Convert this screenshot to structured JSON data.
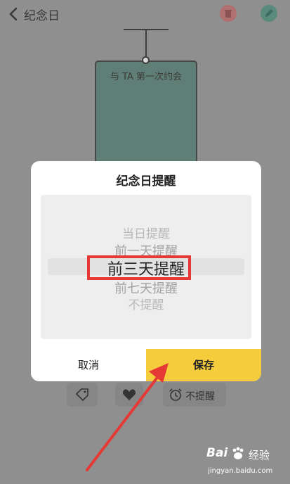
{
  "header": {
    "back_icon": "chevron-left-icon",
    "title": "纪念日",
    "delete_icon": "trash-icon",
    "edit_icon": "pencil-icon",
    "delete_color": "#b07070",
    "edit_color": "#5a8a7c"
  },
  "card": {
    "text": "与 TA 第一次约会",
    "color": "#5f7f76"
  },
  "toolbar": {
    "tag_icon": "tag-icon",
    "heart_icon": "heart-icon",
    "alarm_icon": "alarm-clock-icon",
    "remind_label": "不提醒"
  },
  "dialog": {
    "title": "纪念日提醒",
    "options": [
      "当日提醒",
      "前一天提醒",
      "前三天提醒",
      "前七天提醒",
      "不提醒"
    ],
    "selected": "前三天提醒",
    "cancel_label": "取消",
    "save_label": "保存",
    "save_color": "#f5cc3b"
  },
  "annotation": {
    "highlight_color": "#e53935",
    "arrow_color": "#e53935"
  },
  "watermark": {
    "brand_a": "Bai",
    "brand_b": "经验",
    "url": "jingyan.baidu.com"
  }
}
